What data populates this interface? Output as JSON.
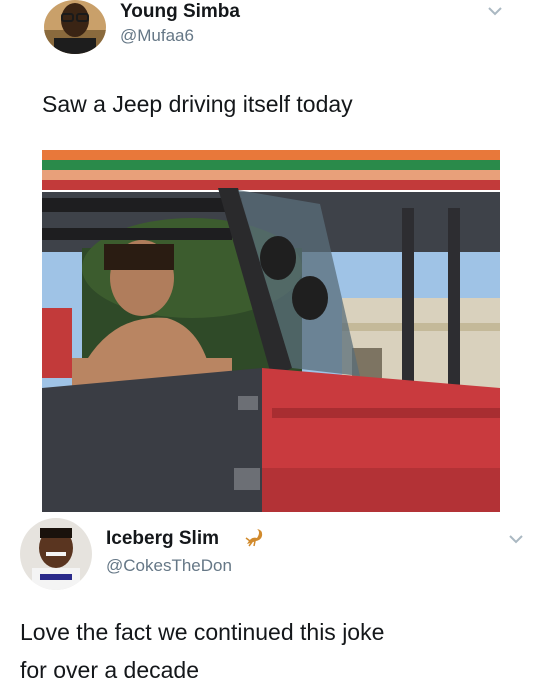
{
  "tweet1": {
    "display_name": "Young Simba",
    "handle": "@Mufaa6",
    "text": "Saw a Jeep driving itself today",
    "avatar_icon": "profile-photo",
    "menu_icon": "chevron-down-icon",
    "image_description": "man-in-red-jeep"
  },
  "tweet2": {
    "display_name": "Iceberg Slim",
    "handle": "@CokesTheDon",
    "text_line1": "Love the fact we continued this joke",
    "text_line2": "for over a decade",
    "name_emoji": "scorpion-icon",
    "menu_icon": "chevron-down-icon",
    "avatar_icon": "profile-photo"
  },
  "colors": {
    "handle_gray": "#657786",
    "text_dark": "#14171a",
    "chevron_gray": "#aab8c2"
  }
}
